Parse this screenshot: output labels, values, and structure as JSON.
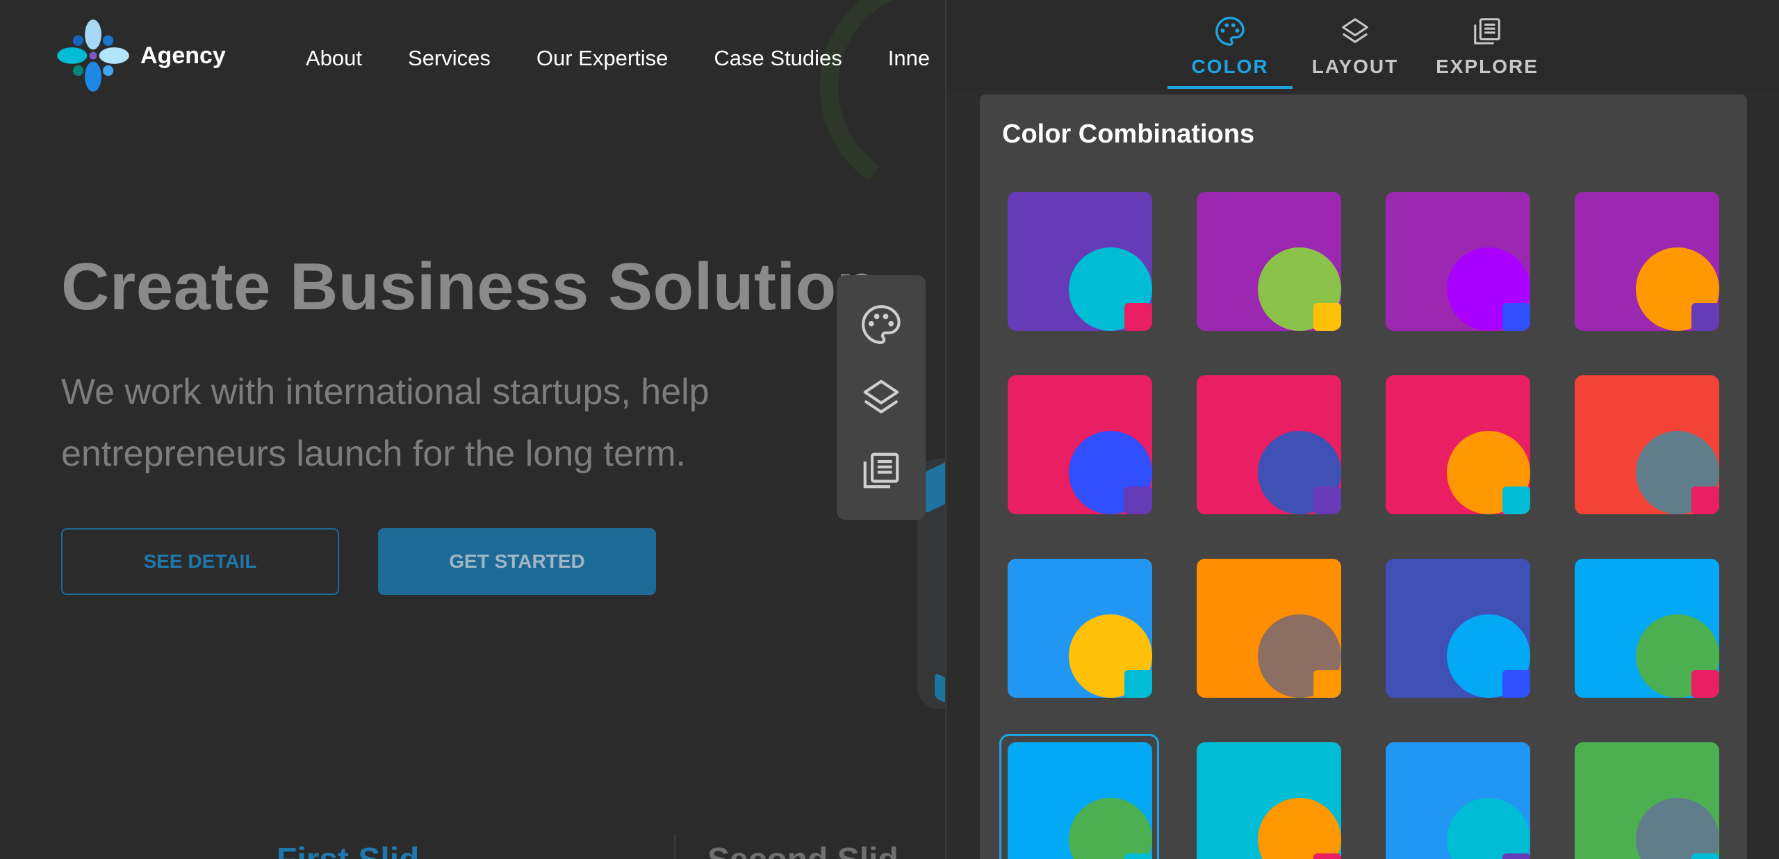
{
  "brand": {
    "name": "Agency"
  },
  "nav": [
    "About",
    "Services",
    "Our Expertise",
    "Case Studies",
    "Inne"
  ],
  "hero": {
    "title": "Create Business Solution",
    "subtitle": "We work with international startups, help entrepreneurs launch for the long term.",
    "detail_button": "SEE DETAIL",
    "start_button": "GET STARTED"
  },
  "slides": {
    "first": "First Slid",
    "second": "Second Slid"
  },
  "toolbar": {
    "icons": [
      "palette-icon",
      "layers-icon",
      "explore-list-icon"
    ]
  },
  "panel": {
    "tabs": [
      {
        "label": "COLOR",
        "icon": "palette-icon",
        "active": true
      },
      {
        "label": "LAYOUT",
        "icon": "layers-icon",
        "active": false
      },
      {
        "label": "EXPLORE",
        "icon": "explore-list-icon",
        "active": false
      }
    ],
    "section_title": "Color Combinations",
    "selected_index": 12,
    "swatches": [
      {
        "primary": "#673ab7",
        "secondary": "#00bcd4",
        "accent": "#e91e63"
      },
      {
        "primary": "#9c27b0",
        "secondary": "#8bc34a",
        "accent": "#ffc107"
      },
      {
        "primary": "#9c27b0",
        "secondary": "#aa00ff",
        "accent": "#304ffe"
      },
      {
        "primary": "#9c27b0",
        "secondary": "#ff9800",
        "accent": "#673ab7"
      },
      {
        "primary": "#e91e63",
        "secondary": "#304ffe",
        "accent": "#673ab7"
      },
      {
        "primary": "#e91e63",
        "secondary": "#3f51b5",
        "accent": "#673ab7"
      },
      {
        "primary": "#e91e63",
        "secondary": "#ff9800",
        "accent": "#00bcd4"
      },
      {
        "primary": "#f44336",
        "secondary": "#607d8b",
        "accent": "#e91e63"
      },
      {
        "primary": "#2196f3",
        "secondary": "#ffc107",
        "accent": "#00bcd4"
      },
      {
        "primary": "#ff8f00",
        "secondary": "#8d6e63",
        "accent": "#ff9800"
      },
      {
        "primary": "#3f51b5",
        "secondary": "#03a9f4",
        "accent": "#304ffe"
      },
      {
        "primary": "#03a9f4",
        "secondary": "#4caf50",
        "accent": "#e91e63"
      },
      {
        "primary": "#03a9f4",
        "secondary": "#4caf50",
        "accent": "#00bcd4"
      },
      {
        "primary": "#00bcd4",
        "secondary": "#ff9800",
        "accent": "#e91e63"
      },
      {
        "primary": "#2196f3",
        "secondary": "#00bcd4",
        "accent": "#673ab7"
      },
      {
        "primary": "#4caf50",
        "secondary": "#607d8b",
        "accent": "#00bcd4"
      }
    ]
  },
  "colors": {
    "accent": "#1fa3e0",
    "background": "#2b2b2b",
    "panel_section": "#444444"
  }
}
